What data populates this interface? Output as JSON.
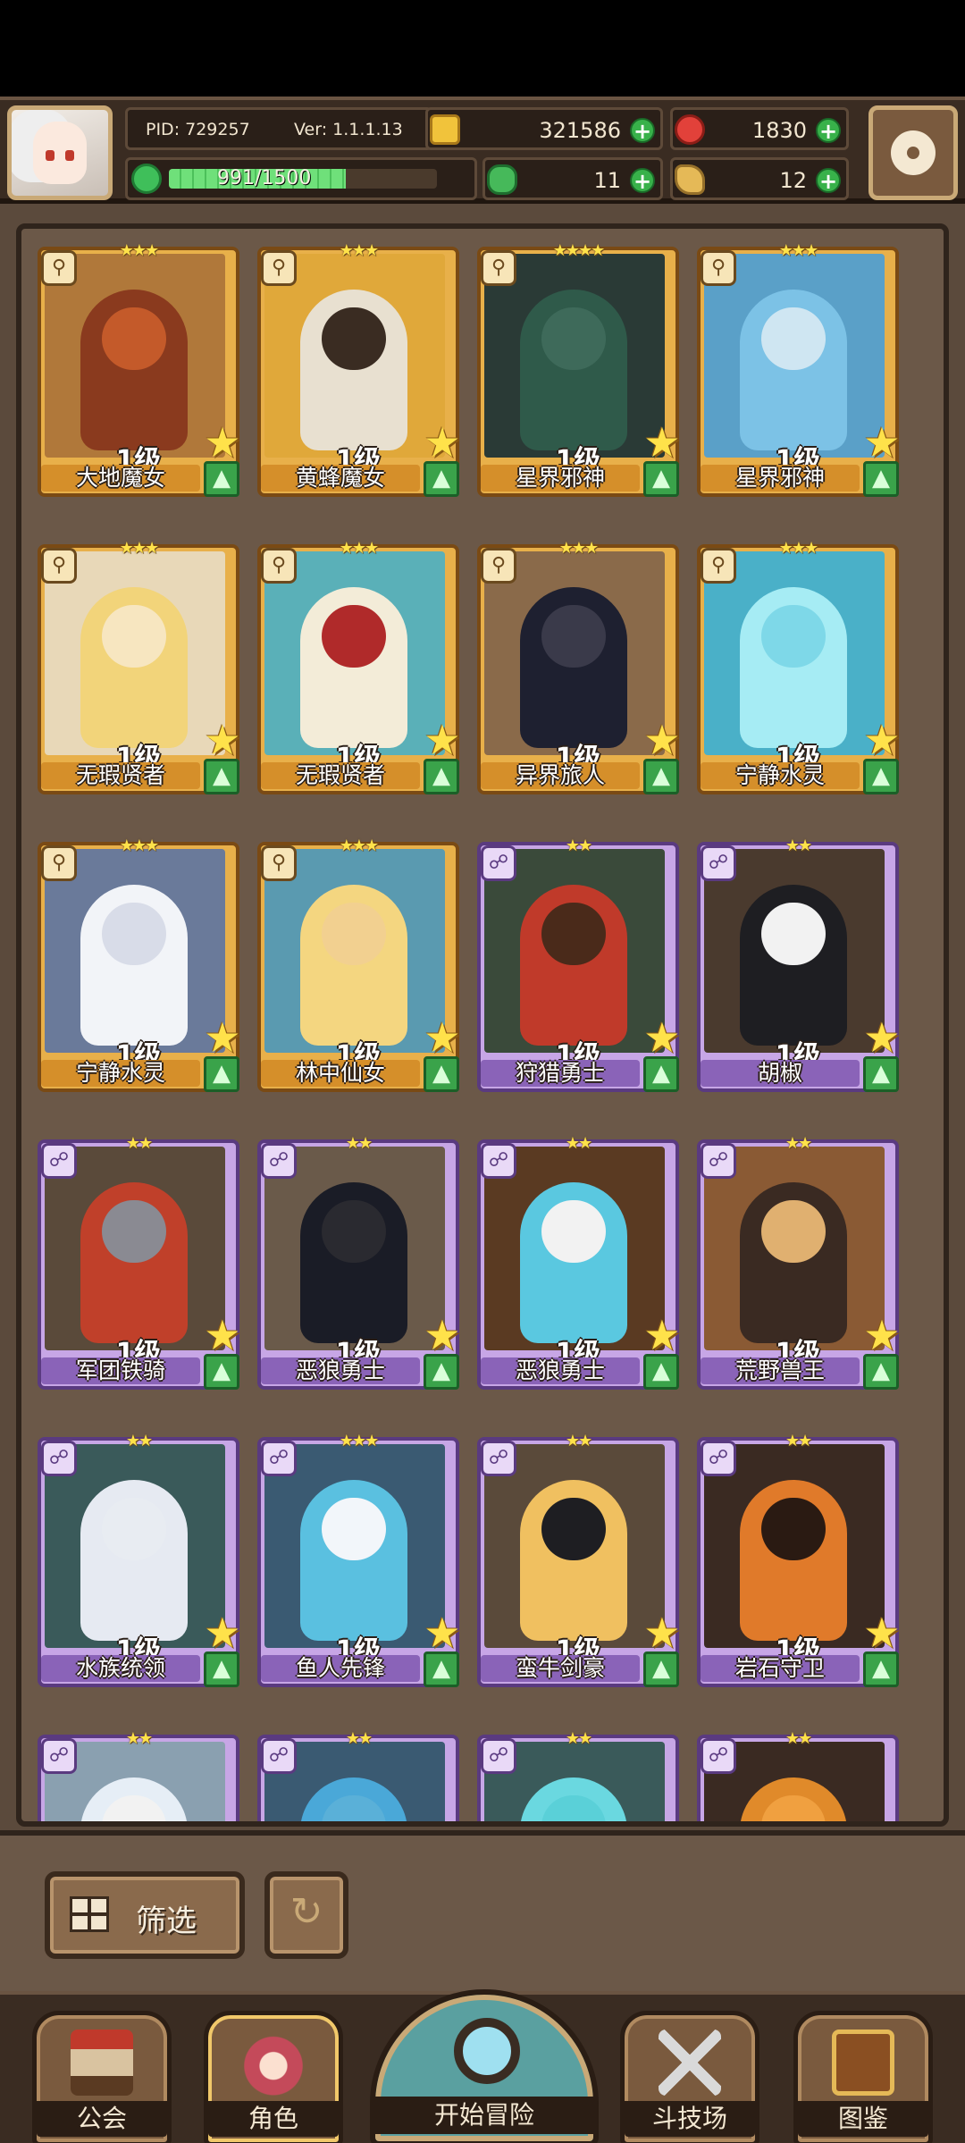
{
  "header": {
    "pid": "PID: 729257",
    "version": "Ver: 1.1.1.13",
    "xp_text": "991/1500",
    "xp_fraction": 0.66,
    "currencies": {
      "gold": "321586",
      "apple": "1830",
      "clover": "11",
      "shard": "12"
    },
    "plus_label": "+"
  },
  "roster": {
    "level_suffix": "级",
    "cards": [
      {
        "name": "大地魔女",
        "level": "1级",
        "stars": "★★★",
        "rarity": "gold",
        "skin": "#c45a2a",
        "hair": "#8a3a1e",
        "bg": "#b0783a"
      },
      {
        "name": "黄蜂魔女",
        "level": "1级",
        "stars": "★★★",
        "rarity": "gold",
        "skin": "#3a2c22",
        "hair": "#e8e0d0",
        "bg": "#e0a83a"
      },
      {
        "name": "星界邪神",
        "level": "1级",
        "stars": "★★★★",
        "rarity": "gold",
        "skin": "#3e6a5a",
        "hair": "#2f5a4a",
        "bg": "#2a3a36"
      },
      {
        "name": "星界邪神",
        "level": "1级",
        "stars": "★★★",
        "rarity": "gold",
        "skin": "#cfe6f2",
        "hair": "#7cc2e6",
        "bg": "#5aa0c8"
      },
      {
        "name": "无瑕贤者",
        "level": "1级",
        "stars": "★★★",
        "rarity": "gold",
        "skin": "#f7e6c0",
        "hair": "#f2d47a",
        "bg": "#e8d8b8"
      },
      {
        "name": "无瑕贤者",
        "level": "1级",
        "stars": "★★★",
        "rarity": "gold",
        "skin": "#b02a2a",
        "hair": "#f3ecd8",
        "bg": "#5ab0b8"
      },
      {
        "name": "异界旅人",
        "level": "1级",
        "stars": "★★★",
        "rarity": "gold",
        "skin": "#3a3a4a",
        "hair": "#1e2030",
        "bg": "#8a6a4a"
      },
      {
        "name": "宁静水灵",
        "level": "1级",
        "stars": "★★★",
        "rarity": "gold",
        "skin": "#7ed8e8",
        "hair": "#a6ecf4",
        "bg": "#4ab0c8"
      },
      {
        "name": "宁静水灵",
        "level": "1级",
        "stars": "★★★",
        "rarity": "gold",
        "skin": "#d8dce8",
        "hair": "#f2f4f8",
        "bg": "#6a7a9a"
      },
      {
        "name": "林中仙女",
        "level": "1级",
        "stars": "★★★",
        "rarity": "gold",
        "skin": "#f2d090",
        "hair": "#f4d680",
        "bg": "#5a9ab0"
      },
      {
        "name": "狩猎勇士",
        "level": "1级",
        "stars": "★★",
        "rarity": "purple",
        "skin": "#4a2a1a",
        "hair": "#c03a2a",
        "bg": "#3a4a3a"
      },
      {
        "name": "胡椒",
        "level": "1级",
        "stars": "★★",
        "rarity": "purple",
        "skin": "#f2f2f2",
        "hair": "#1e1e22",
        "bg": "#4a3a2e"
      },
      {
        "name": "军团铁骑",
        "level": "1级",
        "stars": "★★",
        "rarity": "purple",
        "skin": "#8a8a92",
        "hair": "#c0402a",
        "bg": "#5a4a3a"
      },
      {
        "name": "恶狼勇士",
        "level": "1级",
        "stars": "★★",
        "rarity": "purple",
        "skin": "#2a2a30",
        "hair": "#1a1c26",
        "bg": "#6a5a4a"
      },
      {
        "name": "恶狼勇士",
        "level": "1级",
        "stars": "★★",
        "rarity": "purple",
        "skin": "#f2f2f2",
        "hair": "#5ac8e0",
        "bg": "#5a3a22"
      },
      {
        "name": "荒野兽王",
        "level": "1级",
        "stars": "★★",
        "rarity": "purple",
        "skin": "#e0b070",
        "hair": "#3a2a22",
        "bg": "#8a5a34"
      },
      {
        "name": "水族统领",
        "level": "1级",
        "stars": "★★",
        "rarity": "purple",
        "skin": "#e8ecf2",
        "hair": "#e6eaf2",
        "bg": "#3a5a5a"
      },
      {
        "name": "鱼人先锋",
        "level": "1级",
        "stars": "★★★",
        "rarity": "purple",
        "skin": "#f2f6fa",
        "hair": "#5ac0e0",
        "bg": "#3a5a72"
      },
      {
        "name": "蛮牛剑豪",
        "level": "1级",
        "stars": "★★",
        "rarity": "purple",
        "skin": "#1e1e22",
        "hair": "#f0c060",
        "bg": "#5a4a3a"
      },
      {
        "name": "岩石守卫",
        "level": "1级",
        "stars": "★★",
        "rarity": "purple",
        "skin": "#2a1a12",
        "hair": "#e07a2a",
        "bg": "#3a2a22"
      },
      {
        "name": "",
        "level": "",
        "stars": "★★",
        "rarity": "purple",
        "skin": "#f2f2f2",
        "hair": "#e6eef6",
        "bg": "#8aa0b0"
      },
      {
        "name": "",
        "level": "",
        "stars": "★★",
        "rarity": "purple",
        "skin": "#5ab0d8",
        "hair": "#4aa8d8",
        "bg": "#3a5a72"
      },
      {
        "name": "",
        "level": "",
        "stars": "★★",
        "rarity": "purple",
        "skin": "#5ad0d8",
        "hair": "#6ad8e0",
        "bg": "#3a5a5a"
      },
      {
        "name": "",
        "level": "",
        "stars": "★★",
        "rarity": "purple",
        "skin": "#f0a040",
        "hair": "#e08a2a",
        "bg": "#3a2a22"
      }
    ]
  },
  "filter": {
    "filter_label": "筛选",
    "reset_icon": "refresh-icon"
  },
  "nav": {
    "guild": "公会",
    "characters": "角色",
    "adventure": "开始冒险",
    "arena": "斗技场",
    "codex": "图鉴"
  },
  "colors": {
    "gold_frame": "#e8b04a",
    "purple_frame": "#c7a6e6",
    "panel_bg": "#6b5848",
    "accent_green": "#38b14a"
  }
}
